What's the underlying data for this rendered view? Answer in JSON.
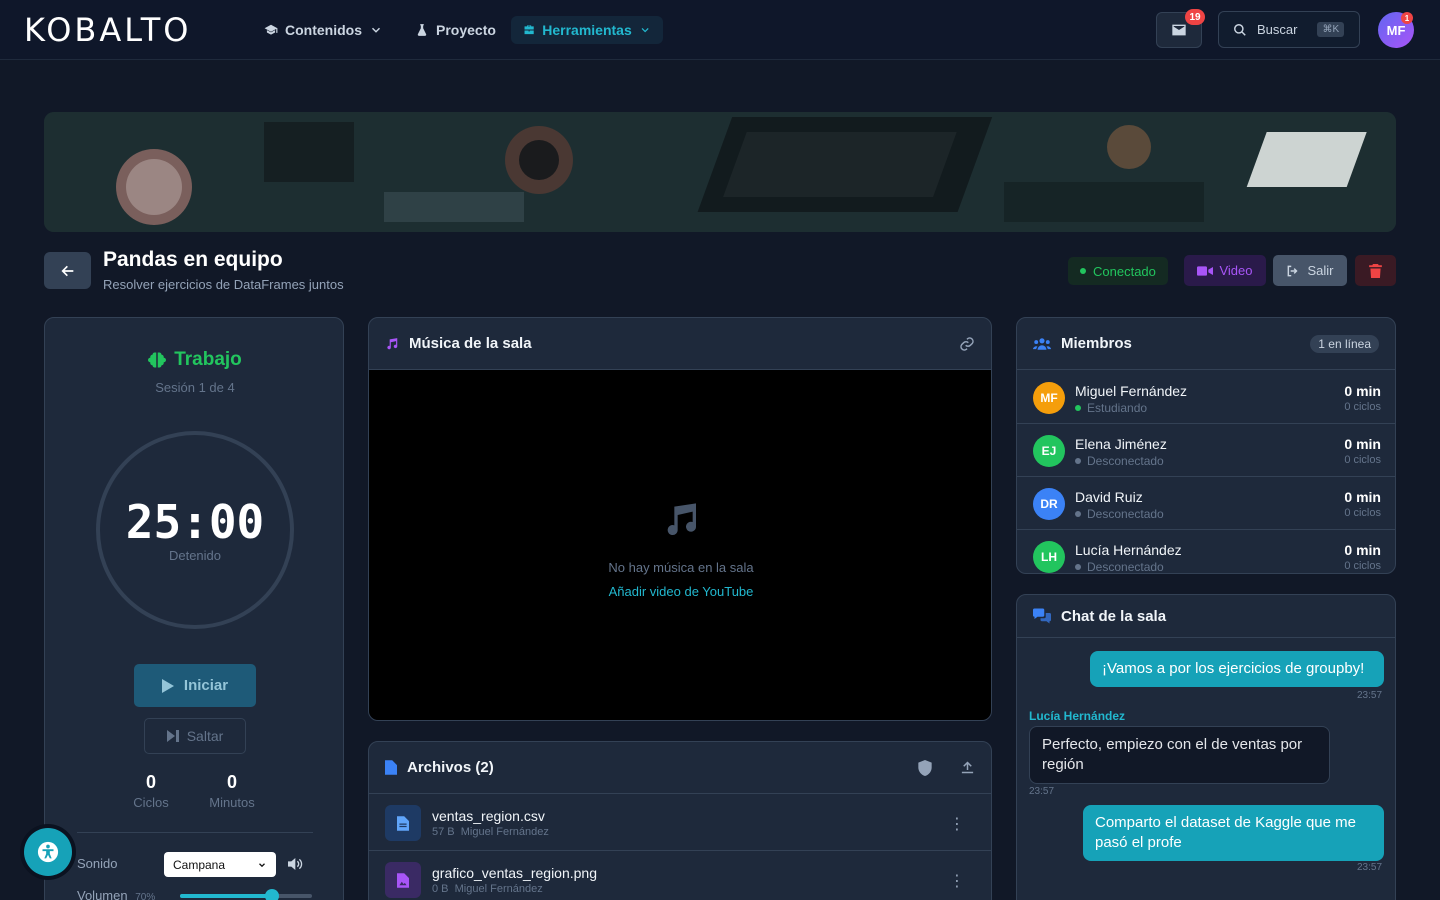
{
  "nav": {
    "logo": "KOBALTO",
    "items": [
      {
        "label": "Contenidos"
      },
      {
        "label": "Proyecto"
      },
      {
        "label": "Herramientas"
      }
    ],
    "mail_count": "19",
    "search_label": "Buscar",
    "search_kbd": "⌘K",
    "user_initials": "MF",
    "user_badge": "1"
  },
  "room": {
    "title": "Pandas en equipo",
    "subtitle": "Resolver ejercicios de DataFrames juntos",
    "status": "Conectado",
    "video_label": "Video",
    "exit_label": "Salir"
  },
  "pomodoro": {
    "mode": "Trabajo",
    "session": "Sesión 1 de 4",
    "time": "25:00",
    "state": "Detenido",
    "start_label": "Iniciar",
    "skip_label": "Saltar",
    "cycles_value": "0",
    "cycles_label": "Ciclos",
    "minutes_value": "0",
    "minutes_label": "Minutos",
    "sound_label": "Sonido",
    "sound_value": "Campana",
    "volume_label": "Volumen",
    "volume_value": "70%",
    "volume_level": 0.7
  },
  "music": {
    "title": "Música de la sala",
    "empty_text": "No hay música en la sala",
    "add_link": "Añadir video de YouTube"
  },
  "files": {
    "title": "Archivos (2)",
    "items": [
      {
        "name": "ventas_region.csv",
        "size": "57 B",
        "owner": "Miguel Fernández"
      },
      {
        "name": "grafico_ventas_region.png",
        "size": "0 B",
        "owner": "Miguel Fernández"
      }
    ]
  },
  "members": {
    "title": "Miembros",
    "online": "1 en línea",
    "list": [
      {
        "initials": "MF",
        "name": "Miguel Fernández",
        "status": "Estudiando",
        "minutes": "0 min",
        "cycles": "0 ciclos",
        "color": "#f59e0b",
        "dot": "#22c55e"
      },
      {
        "initials": "EJ",
        "name": "Elena Jiménez",
        "status": "Desconectado",
        "minutes": "0 min",
        "cycles": "0 ciclos",
        "color": "#22c55e",
        "dot": "#64748b"
      },
      {
        "initials": "DR",
        "name": "David Ruiz",
        "status": "Desconectado",
        "minutes": "0 min",
        "cycles": "0 ciclos",
        "color": "#3b82f6",
        "dot": "#64748b"
      },
      {
        "initials": "LH",
        "name": "Lucía Hernández",
        "status": "Desconectado",
        "minutes": "0 min",
        "cycles": "0 ciclos",
        "color": "#22c55e",
        "dot": "#64748b"
      }
    ]
  },
  "chat": {
    "title": "Chat de la sala",
    "messages": [
      {
        "text": "¡Vamos a por los ejercicios de groupby!",
        "time": "23:57"
      },
      {
        "sender": "Lucía Hernández",
        "text": "Perfecto, empiezo con el de ventas por región",
        "time": "23:57"
      },
      {
        "text": "Comparto el dataset de Kaggle que me pasó el profe",
        "time": "23:57"
      }
    ]
  }
}
